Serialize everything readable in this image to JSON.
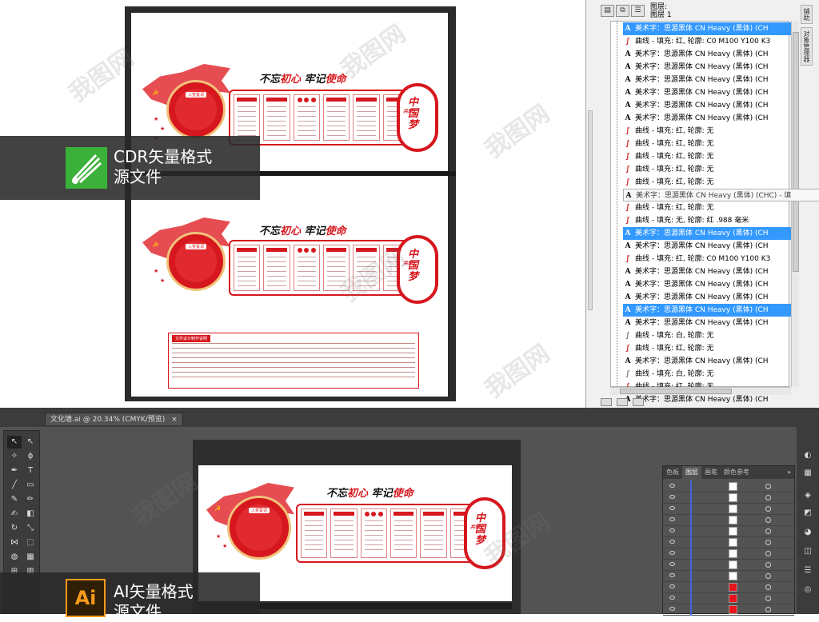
{
  "cdr_document": {
    "banner": {
      "slogan_part1": "不忘",
      "slogan_part2": "初心",
      "slogan_part3": "牢记",
      "slogan_part4": "使命",
      "circle_title": "入党誓词",
      "end_small": "共筑",
      "end_big": "中国梦"
    },
    "spec_box_title": "文件设计制作说明"
  },
  "cdr_tag": {
    "line1": "CDR矢量格式",
    "line2": "源文件"
  },
  "ai_tag": {
    "logo": "Ai",
    "line1": "AI矢量格式",
    "line2": "源文件"
  },
  "object_manager": {
    "header_line1": "图层:",
    "header_line2": "图层 1",
    "side_tabs": [
      "辅助",
      "对象管理器"
    ],
    "rows": [
      {
        "icon": "text",
        "label": "美术字：思源黑体 CN Heavy (黑体) (CH",
        "selected": true
      },
      {
        "icon": "curve",
        "label": "曲线 - 填充: 红, 轮廓: C0 M100 Y100 K3",
        "selected": false
      },
      {
        "icon": "text",
        "label": "美术字：思源黑体 CN Heavy (黑体) (CH",
        "selected": false
      },
      {
        "icon": "text",
        "label": "美术字：思源黑体 CN Heavy (黑体) (CH",
        "selected": false
      },
      {
        "icon": "text",
        "label": "美术字：思源黑体 CN Heavy (黑体) (CH",
        "selected": false
      },
      {
        "icon": "text",
        "label": "美术字：思源黑体 CN Heavy (黑体) (CH",
        "selected": false
      },
      {
        "icon": "text",
        "label": "美术字：思源黑体 CN Heavy (黑体) (CH",
        "selected": false
      },
      {
        "icon": "text",
        "label": "美术字：思源黑体 CN Heavy (黑体) (CH",
        "selected": false
      },
      {
        "icon": "curve",
        "label": "曲线 - 填充: 红, 轮廓: 无",
        "selected": false
      },
      {
        "icon": "curve",
        "label": "曲线 - 填充: 红, 轮廓: 无",
        "selected": false
      },
      {
        "icon": "curve",
        "label": "曲线 - 填充: 红, 轮廓: 无",
        "selected": false
      },
      {
        "icon": "curve",
        "label": "曲线 - 填充: 红, 轮廓: 无",
        "selected": false
      },
      {
        "icon": "curve",
        "label": "曲线 - 填充: 红, 轮廓: 无",
        "selected": false
      },
      {
        "icon": "text",
        "label": "美术字：思源黑体 CN Heavy (黑体) (CHC) - 填",
        "selected": false,
        "tooltip": true
      },
      {
        "icon": "curve",
        "label": "曲线 - 填充: 红, 轮廓: 无",
        "selected": false
      },
      {
        "icon": "curve",
        "label": "曲线 - 填充: 无, 轮廓: 红 .988 毫米",
        "selected": false
      },
      {
        "icon": "text",
        "label": "美术字：思源黑体 CN Heavy (黑体) (CH",
        "selected": true
      },
      {
        "icon": "text",
        "label": "美术字：思源黑体 CN Heavy (黑体) (CH",
        "selected": false
      },
      {
        "icon": "curve",
        "label": "曲线 - 填充: 红, 轮廓: C0 M100 Y100 K3",
        "selected": false
      },
      {
        "icon": "text",
        "label": "美术字：思源黑体 CN Heavy (黑体) (CH",
        "selected": false
      },
      {
        "icon": "text",
        "label": "美术字：思源黑体 CN Heavy (黑体) (CH",
        "selected": false
      },
      {
        "icon": "text",
        "label": "美术字：思源黑体 CN Heavy (黑体) (CH",
        "selected": false
      },
      {
        "icon": "text",
        "label": "美术字：思源黑体 CN Heavy (黑体) (CH",
        "selected": true
      },
      {
        "icon": "text",
        "label": "美术字：思源黑体 CN Heavy (黑体) (CH",
        "selected": false
      },
      {
        "icon": "curve-white",
        "label": "曲线 - 填充: 白, 轮廓: 无",
        "selected": false
      },
      {
        "icon": "curve",
        "label": "曲线 - 填充: 红, 轮廓: 无",
        "selected": false
      },
      {
        "icon": "text",
        "label": "美术字：思源黑体 CN Heavy (黑体) (CH",
        "selected": false
      },
      {
        "icon": "curve-white",
        "label": "曲线 - 填充: 白, 轮廓: 无",
        "selected": false
      },
      {
        "icon": "curve",
        "label": "曲线 - 填充: 红, 轮廓: 无",
        "selected": false
      },
      {
        "icon": "text",
        "label": "美术字：思源黑体 CN Heavy (黑体) (CH",
        "selected": false
      }
    ]
  },
  "illustrator": {
    "doc_tab": "文化墙.ai @ 20.34% (CMYK/预览)",
    "doc_tab_close": "×",
    "layers_tabs": [
      "色板",
      "图层",
      "画笔",
      "颜色参考"
    ],
    "layers_more": "»",
    "layer_swatches": [
      "#ffffff",
      "#ffffff",
      "#ffffff",
      "#ffffff",
      "#ffffff",
      "#ffffff",
      "#ffffff",
      "#ffffff",
      "#ffffff",
      "#e8141c",
      "#e8141c",
      "#e8141c"
    ]
  },
  "colors": {
    "brand_red": "#d6171e",
    "cdr_logo_green": "#3bb03a",
    "ai_logo_orange": "#f79a1c",
    "selection_blue": "#3399ff"
  },
  "watermark": "我图网"
}
